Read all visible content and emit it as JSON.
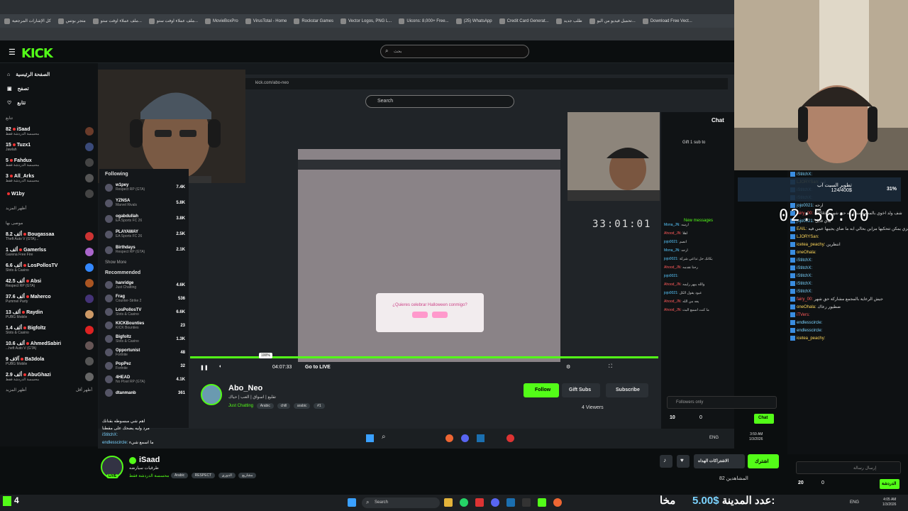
{
  "bookmarks": [
    "كل الإشارات المرجعية",
    "متجر بوتس",
    "ملف عملاء اوفت ستو...",
    "ملف عملاء اوفت ستو...",
    "MovieBoxPro",
    "VirusTotal - Home",
    "Rockstar Games",
    "Vector Logos, PNG L...",
    "Uicons: 8,000+ Free...",
    "(25) WhatsApp",
    "Credit Card Generat...",
    "طلب جديد",
    "تحميل فيديو من اليو...",
    "Download Free Vect..."
  ],
  "header": {
    "search_placeholder": "بحث"
  },
  "sidebar": {
    "nav": [
      "الصفحة الرئيسية",
      "تصفح",
      "تتابع"
    ],
    "following_title": "تتابع",
    "following": [
      {
        "name": "iSaad",
        "game": "محسسة الدردشة فقط",
        "count": "82",
        "avatar_color": "#6a3b2a"
      },
      {
        "name": "Tuzx1",
        "game": "Jawlah",
        "count": "15",
        "avatar_color": "#3a4a7a"
      },
      {
        "name": "Fahdux",
        "game": "محسسة الدردشة فقط",
        "count": "5",
        "avatar_color": "#444"
      },
      {
        "name": "All_Arks",
        "game": "محسسة الدردشة فقط",
        "count": "3",
        "avatar_color": "#555"
      },
      {
        "name": "W1by",
        "game": "",
        "count": "",
        "avatar_color": "#444"
      }
    ],
    "more_label": "أظهر المزيد",
    "recommended_title": "موصى بها",
    "recommended": [
      {
        "name": "Bougassaa",
        "game": "Theft Auto V (GTA)...",
        "count": "8.2 ألف"
      },
      {
        "name": "Gamerlss",
        "game": "Garena Free Fire",
        "count": "1 ألف"
      },
      {
        "name": "LosPollosTV",
        "game": "Slots & Casino",
        "count": "6.6 ألف"
      },
      {
        "name": "Absi",
        "game": "Respect RP (GTA)",
        "count": "42.5 ألف"
      },
      {
        "name": "Maherco",
        "game": "Pummel Party",
        "count": "37.6 ألف"
      },
      {
        "name": "Raydin",
        "game": "PUBG Mobile",
        "count": "13 ألف"
      },
      {
        "name": "Bigfoltz",
        "game": "Slots & Casino",
        "count": "1.4 ألف"
      },
      {
        "name": "AhmedSabiri",
        "game": "...heft Auto V (GTA)",
        "count": "10.6 ألف"
      },
      {
        "name": "Ba3dola",
        "game": "PUBG Mobile",
        "count": "9 آلاف"
      },
      {
        "name": "AbuGhazi",
        "game": "محسسة الدردشة فقط",
        "count": "2.9 ألف"
      }
    ],
    "show_more": "أظهر المزيد",
    "show_less": "أظهر أقل"
  },
  "inner": {
    "address": "kick.com/abo-neo",
    "search": "Search",
    "following_title": "Following",
    "following": [
      {
        "name": "w1pey",
        "game": "Respect RP (GTA)",
        "count": "7.4K"
      },
      {
        "name": "YZNSA",
        "game": "Marvel Rivals",
        "count": "5.8K"
      },
      {
        "name": "ogabdullah",
        "game": "EA Sports FC 26",
        "count": "3.8K"
      },
      {
        "name": "PLAYAWAY",
        "game": "EA Sports FC 26",
        "count": "2.5K"
      },
      {
        "name": "Birthdays",
        "game": "Respect RP (GTA)",
        "count": "2.1K"
      }
    ],
    "show_more": "Show More",
    "recommended_title": "Recommended",
    "recommended": [
      {
        "name": "hanridge",
        "game": "Just Chatting",
        "count": "4.6K"
      },
      {
        "name": "Frag",
        "game": "Counter-Strike 2",
        "count": "536"
      },
      {
        "name": "LosPollosTV",
        "game": "Slots & Casino",
        "count": "6.6K"
      },
      {
        "name": "KICKBounties",
        "game": "KICK Bounties",
        "count": "23"
      },
      {
        "name": "Bigfoltz",
        "game": "Slots & Casino",
        "count": "1.3K"
      },
      {
        "name": "Opportunist",
        "game": "Fortnite",
        "count": "48"
      },
      {
        "name": "PopPez",
        "game": "Fortnite",
        "count": "32"
      },
      {
        "name": "4HEAD",
        "game": "No Pixel RP (GTA)",
        "count": "4.1K"
      },
      {
        "name": "dtanmanb",
        "game": "",
        "count": "361"
      }
    ],
    "dialog_text": "¿Quieres celebrar Halloween conmigo?",
    "volume": "100%",
    "time": "04:07:33",
    "go_live": "Go to LIVE",
    "clock": "33:01:01",
    "streamer": "Abo_Neo",
    "stream_title": "تقليع | اسواق | العب | حياك",
    "category": "Just Chatting",
    "tags": [
      "Arabic",
      "chill",
      "arabic",
      "#1"
    ],
    "follow": "Follow",
    "gift_subs": "Gift Subs",
    "subscribe": "Subscribe",
    "viewers": "4 Viewers",
    "chat_title": "Chat",
    "gift_banner": "Gift 1 sub to",
    "new_messages": "New messages",
    "followers_only": "Followers only",
    "chat_button": "Chat",
    "points": "10",
    "zero": "0",
    "taskbar_time": "3:59 AM",
    "taskbar_date": "1/3/2026",
    "taskbar_lang": "ENG",
    "chat_lines": [
      {
        "user": "Mona_JN:",
        "msg": "ارسه"
      },
      {
        "user": "Ahood_JN:",
        "msg": "اهلا"
      },
      {
        "user": "jojo0021:",
        "msg": "انصم"
      },
      {
        "user": "Mona_JN:",
        "msg": "ارحه"
      },
      {
        "user": "jojo0021:",
        "msg": "بكانك حل تداعي شركة"
      },
      {
        "user": "Ahood_JN:",
        "msg": "رحنا نقدمه"
      },
      {
        "user": "jojo0021:",
        "msg": ""
      },
      {
        "user": "Ahood_JN:",
        "msg": "والله يبهر رايمه"
      },
      {
        "user": "jojo0021:",
        "msg": "عبود يقول الكل"
      },
      {
        "user": "Ahood_JN:",
        "msg": "يعه من الله"
      },
      {
        "user": "Ahood_JN:",
        "msg": "ما كنت اسمع البث"
      }
    ]
  },
  "overlay_chat": [
    {
      "user": "iStitchX:",
      "msg": ""
    },
    {
      "user": "endlesscircle:",
      "msg": "ما اسمع شيء"
    }
  ],
  "overlay_chat_top": "اهم شي مبسوطه بقنانك",
  "overlay_chat_mid": "مرد وليه يضحك على مقطنا",
  "bottom": {
    "streamer": "iSaad",
    "title": "طرقيات سيارضه",
    "category": "محسسة الدردشة فقط",
    "tags": [
      "Arabic",
      "RESPECT",
      "الدوري",
      "مشاريع"
    ],
    "live": "LIVE",
    "subscribe": "اشترك",
    "gift_subs": "الاشتراكات الهداه",
    "watchers": "82 المشاهدين"
  },
  "overlay": {
    "timer": "02:56:00",
    "goal_title": "تطوير السيت اب",
    "goal_amount": "124/400$",
    "goal_pct": "31%"
  },
  "right_chat": {
    "lines": [
      {
        "user": "iStitchX:",
        "msg": "",
        "color": "cyan"
      },
      {
        "user": "LJORYSan:",
        "msg": "اوه",
        "color": "yellow"
      },
      {
        "user": "iStitchX:",
        "msg": "",
        "color": "cyan"
      },
      {
        "user": "iStitchX:",
        "msg": "",
        "color": "cyan"
      },
      {
        "user": "jojo0021:",
        "msg": "ارحه",
        "color": "cyan"
      },
      {
        "user": "fairy_00:",
        "msg": "@iSaad شف ولد اخوي بالمجمع مشاركه حق شهر",
        "color": "red"
      },
      {
        "user": "jojo0021:",
        "msg": "هاي قايل",
        "color": "cyan"
      },
      {
        "user": "EAIL:",
        "msg": "جيزي يمكن تتحكيها مزاين بحالي ابه ما ضاي يجيبها عمي فيه",
        "color": "yellow"
      },
      {
        "user": "LJORYSan:",
        "msg": "",
        "color": "yellow"
      },
      {
        "user": "icetea_peachy:",
        "msg": "انتظرين",
        "color": "yellow"
      },
      {
        "user": "oneOhala:",
        "msg": "",
        "color": "yellow"
      },
      {
        "user": "iStitchX:",
        "msg": "",
        "color": "cyan"
      },
      {
        "user": "iStitchX:",
        "msg": "",
        "color": "cyan"
      },
      {
        "user": "iStitchX:",
        "msg": "",
        "color": "cyan"
      },
      {
        "user": "iStitchX:",
        "msg": "",
        "color": "cyan"
      },
      {
        "user": "iStitchX:",
        "msg": "",
        "color": "cyan"
      },
      {
        "user": "fairy_00:",
        "msg": "جيش الرعاية بالمجمع مشاركة حق شهر",
        "color": "red"
      },
      {
        "user": "oneOhala:",
        "msg": "ضطيور رعاك",
        "color": "yellow"
      },
      {
        "user": "iTVers:",
        "msg": "",
        "color": "red"
      },
      {
        "user": "endlesscircle:",
        "msg": "",
        "color": "cyan"
      },
      {
        "user": "endlesscircle:",
        "msg": "",
        "color": "cyan"
      },
      {
        "user": "icetea_peachy:",
        "msg": "",
        "color": "yellow"
      }
    ],
    "input_placeholder": "إرسال رسالة",
    "points": "20",
    "zero": "0",
    "chat_button": "الدردشة"
  },
  "taskbar": {
    "kick_count": "4",
    "city_label": "عدد المدينة:",
    "city_value": "5.00$",
    "makha": "مخا",
    "search": "Search",
    "lang": "ENG",
    "time": "4:05 AM",
    "date": "1/3/2026"
  },
  "colors": {
    "kick_green": "#53fc18",
    "bg": "#0b0e0f"
  }
}
